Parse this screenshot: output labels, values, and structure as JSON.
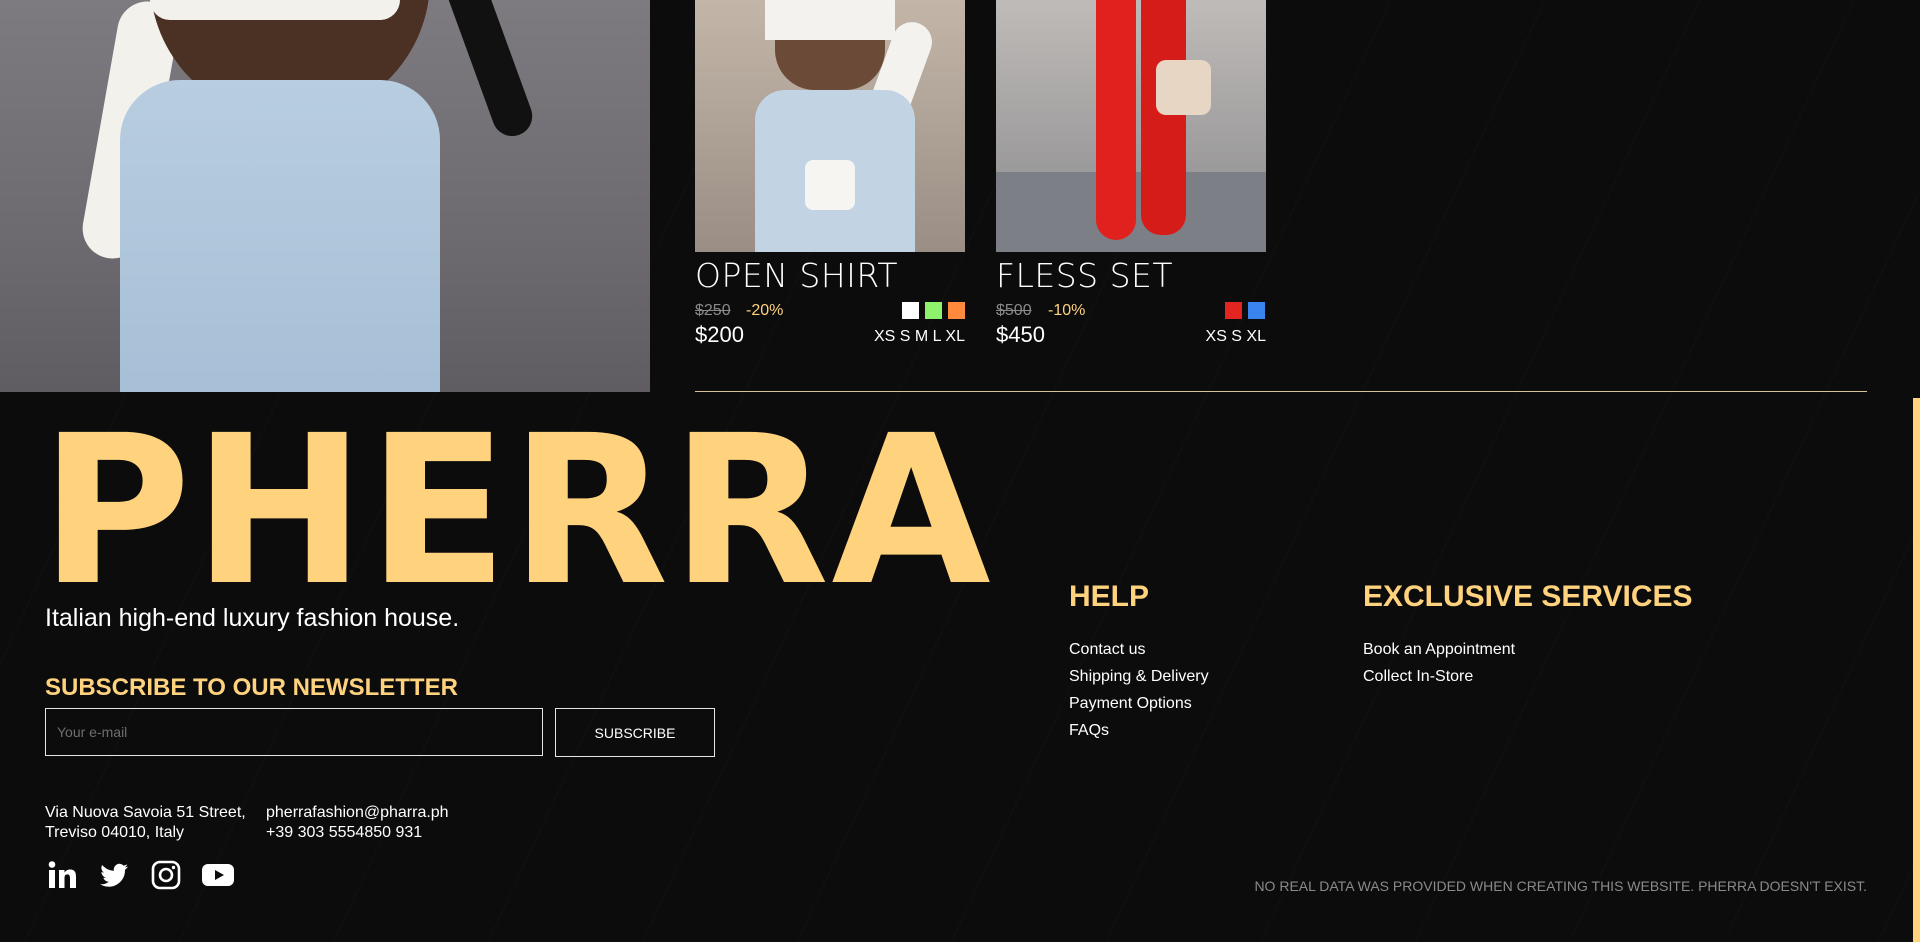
{
  "products": [
    {
      "name": "OPEN SHIRT",
      "old_price": "$250",
      "discount": "-20%",
      "price": "$200",
      "colors": [
        "#ffffff",
        "#8ef36c",
        "#ff8a3d"
      ],
      "sizes": "XS S M L XL"
    },
    {
      "name": "FLESS SET",
      "old_price": "$500",
      "discount": "-10%",
      "price": "$450",
      "colors": [
        "#e32420",
        "#3a84f0"
      ],
      "sizes": "XS S XL"
    }
  ],
  "footer": {
    "brand": "PHERRA",
    "tagline": "Italian high-end luxury fashion house.",
    "newsletter": {
      "title": "SUBSCRIBE TO OUR NEWSLETTER",
      "placeholder": "Your e-mail",
      "button": "SUBSCRIBE"
    },
    "address": {
      "line1": "Via Nuova Savoia 51 Street,",
      "line2": "Treviso 04010, Italy"
    },
    "contact": {
      "email": "pherrafashion@pharra.ph",
      "phone": "+39 303 5554850 931"
    },
    "social": [
      "linkedin-icon",
      "twitter-icon",
      "instagram-icon",
      "youtube-icon"
    ],
    "help": {
      "title": "HELP",
      "items": [
        "Contact us",
        "Shipping & Delivery",
        "Payment Options",
        "FAQs"
      ]
    },
    "services": {
      "title": "EXCLUSIVE SERVICES",
      "items": [
        "Book an Appointment",
        "Collect In-Store"
      ]
    },
    "disclaimer": "NO REAL DATA WAS PROVIDED WHEN CREATING THIS WEBSITE. PHERRA DOESN'T EXIST."
  },
  "colors": {
    "accent": "#ffd27d",
    "background": "#0c0c0d"
  }
}
